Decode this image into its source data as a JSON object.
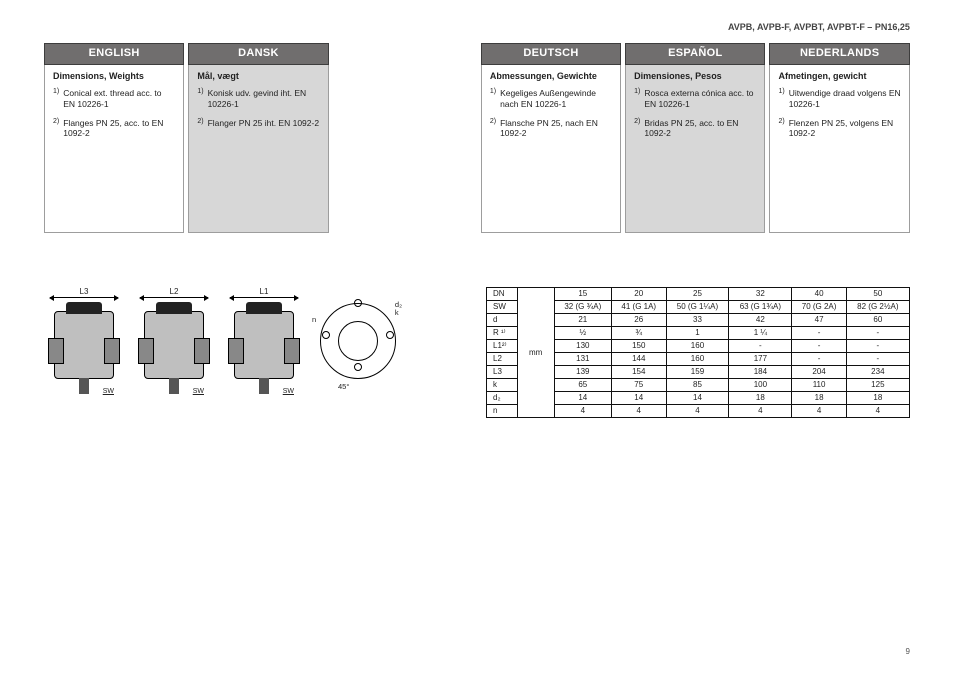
{
  "doc_header": "AVPB, AVPB-F, AVPBT, AVPBT-F – PN16,25",
  "page_number": "9",
  "langs": [
    {
      "code": "english",
      "zebra": false,
      "title": "ENGLISH",
      "subtitle": "Dimensions, Weights",
      "notes": [
        "Conical ext. thread acc. to EN 10226-1",
        "Flanges PN 25, acc. to EN 1092-2"
      ]
    },
    {
      "code": "dansk",
      "zebra": true,
      "title": "DANSK",
      "subtitle": "Mål, vægt",
      "notes": [
        "Konisk udv. gevind iht. EN 10226-1",
        "Flanger PN 25 iht. EN 1092-2"
      ]
    },
    {
      "code": "spacer"
    },
    {
      "code": "deutsch",
      "zebra": false,
      "title": "DEUTSCH",
      "subtitle": "Abmessungen, Gewichte",
      "notes": [
        "Kegeliges Außengewinde nach EN 10226-1",
        "Flansche PN 25, nach EN 1092-2"
      ]
    },
    {
      "code": "espanol",
      "zebra": true,
      "title": "ESPAÑOL",
      "subtitle": "Dimensiones, Pesos",
      "notes": [
        "Rosca externa cónica acc. to EN 10226-1",
        "Bridas PN 25, acc. to EN 1092-2"
      ]
    },
    {
      "code": "nederlands",
      "zebra": false,
      "title": "NEDERLANDS",
      "subtitle": "Afmetingen, gewicht",
      "notes": [
        "Uitwendige draad volgens EN 10226-1",
        "Flenzen PN 25, volgens EN 1092-2"
      ]
    }
  ],
  "drawings": {
    "views": [
      {
        "dim": "L3"
      },
      {
        "dim": "L2"
      },
      {
        "dim": "L1"
      }
    ],
    "sw_label": "SW",
    "flange": {
      "n": "n",
      "d2": "d₂",
      "k": "k",
      "angle": "45°"
    }
  },
  "table": {
    "unit_label": "mm",
    "rows": [
      {
        "label": "DN",
        "vals": [
          "15",
          "20",
          "25",
          "32",
          "40",
          "50"
        ]
      },
      {
        "label": "SW",
        "vals": [
          "32 (G ¾A)",
          "41 (G 1A)",
          "50 (G 1¼A)",
          "63 (G 1¾A)",
          "70 (G 2A)",
          "82 (G 2½A)"
        ]
      },
      {
        "label": "d",
        "vals": [
          "21",
          "26",
          "33",
          "42",
          "47",
          "60"
        ]
      },
      {
        "label": "R ¹⁾",
        "vals": [
          "½",
          "¾",
          "1",
          "1 ¼",
          "-",
          "-"
        ]
      },
      {
        "label": "L1²⁾",
        "vals": [
          "130",
          "150",
          "160",
          "-",
          "-",
          "-"
        ]
      },
      {
        "label": "L2",
        "vals": [
          "131",
          "144",
          "160",
          "177",
          "-",
          "-"
        ]
      },
      {
        "label": "L3",
        "vals": [
          "139",
          "154",
          "159",
          "184",
          "204",
          "234"
        ]
      },
      {
        "label": "k",
        "vals": [
          "65",
          "75",
          "85",
          "100",
          "110",
          "125"
        ]
      },
      {
        "label": "d₂",
        "vals": [
          "14",
          "14",
          "14",
          "18",
          "18",
          "18"
        ]
      },
      {
        "label": "n",
        "vals": [
          "4",
          "4",
          "4",
          "4",
          "4",
          "4"
        ]
      }
    ]
  }
}
